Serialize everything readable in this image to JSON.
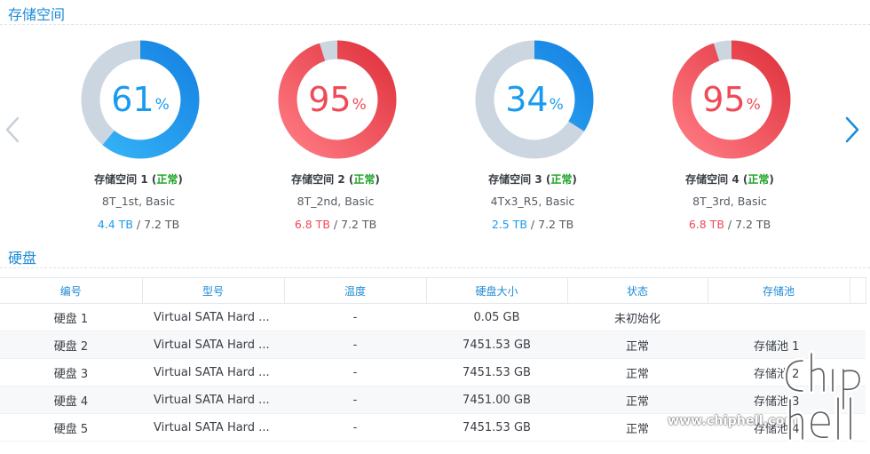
{
  "storage_section": {
    "title": "存储空间"
  },
  "disks_section": {
    "title": "硬盘"
  },
  "volumes": [
    {
      "percent": "61",
      "percent_value": 61,
      "pct_sign": "%",
      "name": "存储空间 1",
      "status": "正常",
      "desc": "8T_1st, Basic",
      "used": "4.4 TB",
      "sep": " / ",
      "total": "7.2 TB",
      "color": "#1a9bef"
    },
    {
      "percent": "95",
      "percent_value": 95,
      "pct_sign": "%",
      "name": "存储空间 2",
      "status": "正常",
      "desc": "8T_2nd, Basic",
      "used": "6.8 TB",
      "sep": " / ",
      "total": "7.2 TB",
      "color": "#ef4a57"
    },
    {
      "percent": "34",
      "percent_value": 34,
      "pct_sign": "%",
      "name": "存储空间 3",
      "status": "正常",
      "desc": "4Tx3_R5, Basic",
      "used": "2.5 TB",
      "sep": " / ",
      "total": "7.2 TB",
      "color": "#1a9bef"
    },
    {
      "percent": "95",
      "percent_value": 95,
      "pct_sign": "%",
      "name": "存储空间 4",
      "status": "正常",
      "desc": "8T_3rd, Basic",
      "used": "6.8 TB",
      "sep": " / ",
      "total": "7.2 TB",
      "color": "#ef4a57"
    }
  ],
  "table": {
    "headers": [
      "编号",
      "型号",
      "温度",
      "硬盘大小",
      "状态",
      "存储池"
    ],
    "rows": [
      {
        "id": "硬盘 1",
        "model": "Virtual SATA Hard ...",
        "temp": "-",
        "size": "0.05 GB",
        "status": "未初始化",
        "pool": ""
      },
      {
        "id": "硬盘 2",
        "model": "Virtual SATA Hard ...",
        "temp": "-",
        "size": "7451.53 GB",
        "status": "正常",
        "pool": "存储池 1"
      },
      {
        "id": "硬盘 3",
        "model": "Virtual SATA Hard ...",
        "temp": "-",
        "size": "7451.53 GB",
        "status": "正常",
        "pool": "存储池 2"
      },
      {
        "id": "硬盘 4",
        "model": "Virtual SATA Hard ...",
        "temp": "-",
        "size": "7451.00 GB",
        "status": "正常",
        "pool": "存储池 3"
      },
      {
        "id": "硬盘 5",
        "model": "Virtual SATA Hard ...",
        "temp": "-",
        "size": "7451.53 GB",
        "status": "正常",
        "pool": "存储池 4"
      }
    ]
  },
  "watermark": {
    "url": "www.chiphell.com",
    "logo_text": "chip hell"
  },
  "colors": {
    "accent": "#1d8bd6",
    "ok": "#1aa324",
    "warn": "#ef4a57",
    "ring_track": "#ccd6e0"
  },
  "icons": {
    "prev": "chevron-left-icon",
    "next": "chevron-right-icon"
  }
}
